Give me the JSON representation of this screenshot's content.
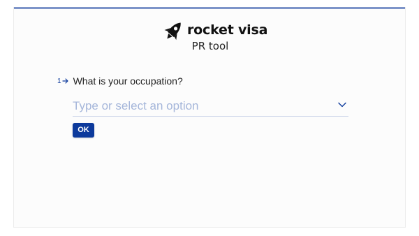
{
  "brand": {
    "name": "rocket visa",
    "subtitle": "PR tool",
    "icon": "rocket-icon"
  },
  "question": {
    "number": "1",
    "arrow_icon": "arrow-right-icon",
    "text": "What is your occupation?"
  },
  "dropdown": {
    "value": "",
    "placeholder": "Type or select an option",
    "icon": "chevron-down-icon"
  },
  "ok_button": {
    "label": "OK"
  },
  "colors": {
    "accent": "#0d3a9c",
    "top_bar": "#7d94c9",
    "placeholder": "#a5b6da"
  }
}
